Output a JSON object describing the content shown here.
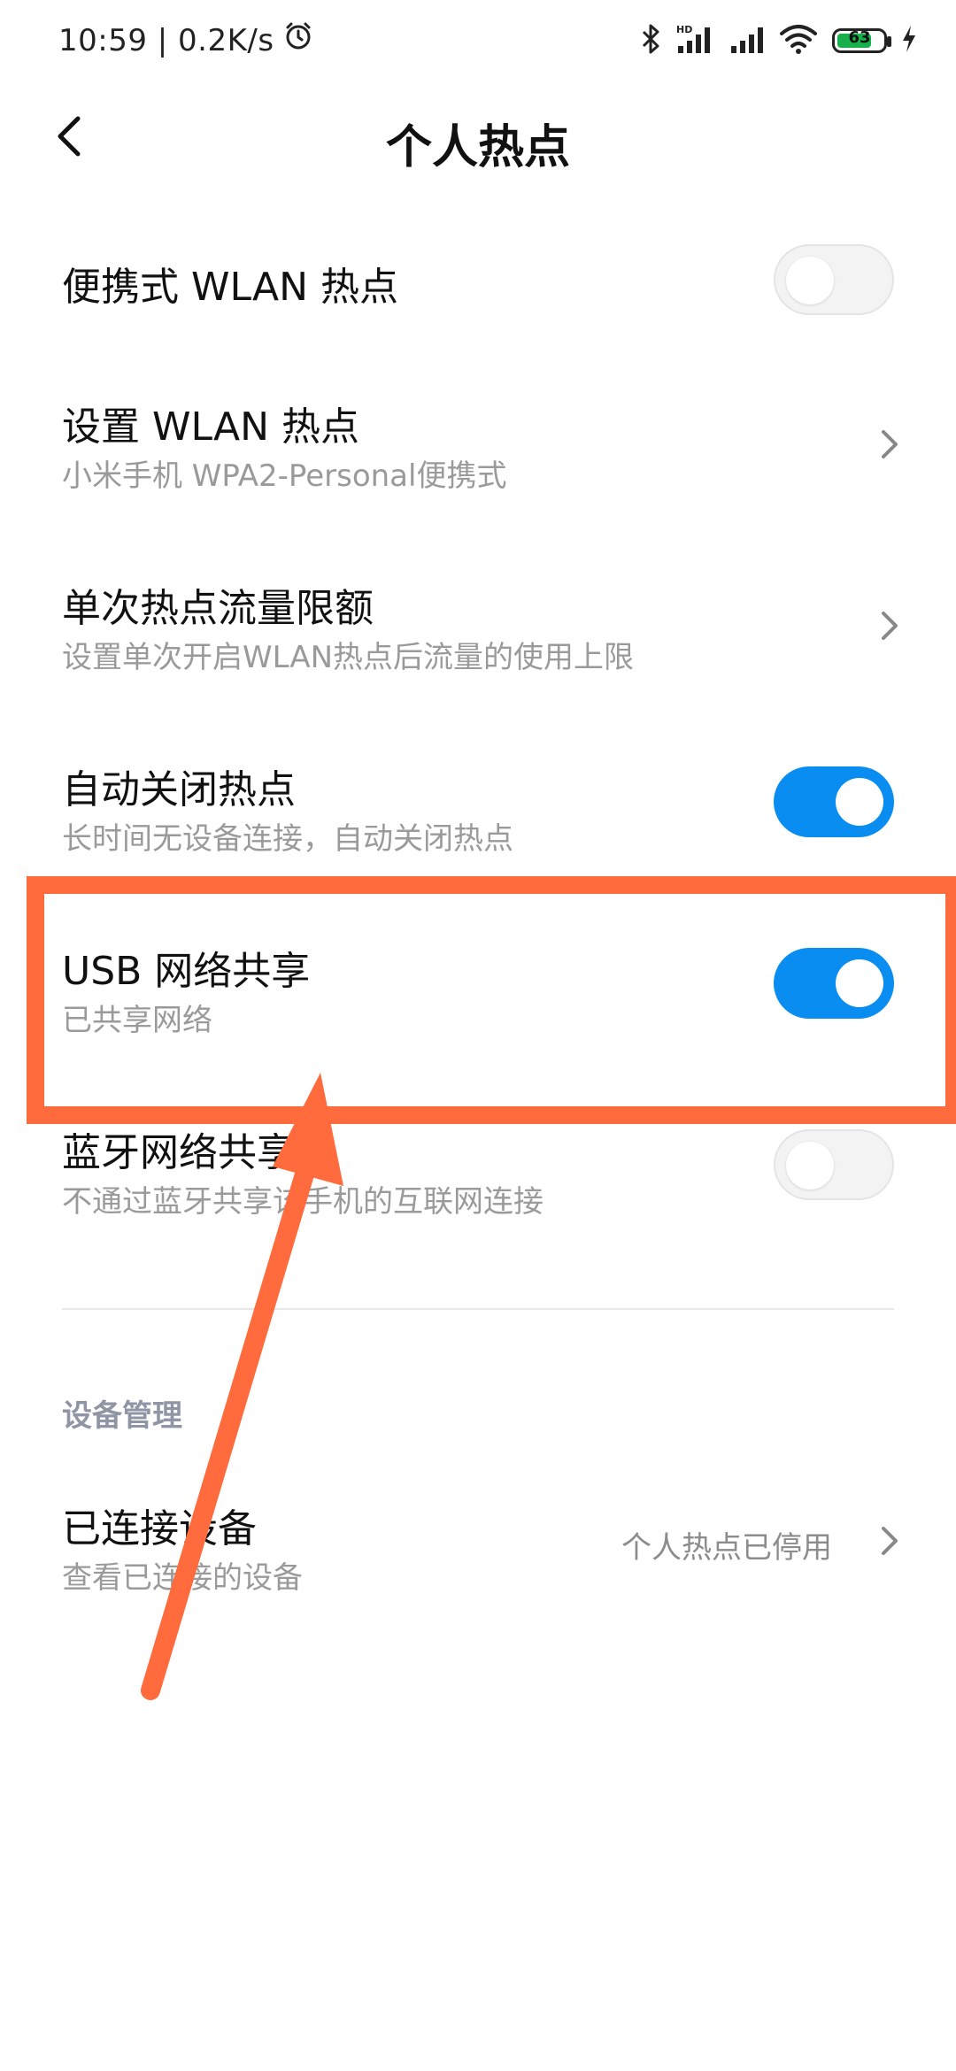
{
  "status_bar": {
    "time_speed": "10:59 | 0.2K/s",
    "battery_level": "63",
    "icons": [
      "alarm-icon",
      "bluetooth-icon",
      "hd-signal-icon",
      "signal-icon",
      "wifi-icon",
      "battery-icon",
      "charging-icon"
    ]
  },
  "header": {
    "title": "个人热点"
  },
  "settings": {
    "portable_hotspot": {
      "title": "便携式 WLAN 热点",
      "enabled": false
    },
    "setup_hotspot": {
      "title": "设置 WLAN 热点",
      "subtitle": "小米手机 WPA2-Personal便携式"
    },
    "data_limit": {
      "title": "单次热点流量限额",
      "subtitle": "设置单次开启WLAN热点后流量的使用上限"
    },
    "auto_off": {
      "title": "自动关闭热点",
      "subtitle": "长时间无设备连接，自动关闭热点",
      "enabled": true
    },
    "usb_tethering": {
      "title": "USB 网络共享",
      "subtitle": "已共享网络",
      "enabled": true
    },
    "bt_tethering": {
      "title": "蓝牙网络共享",
      "subtitle": "不通过蓝牙共享该手机的互联网连接",
      "enabled": false
    }
  },
  "device_management": {
    "section_title": "设备管理",
    "connected_devices": {
      "title": "已连接设备",
      "subtitle": "查看已连接的设备",
      "value": "个人热点已停用"
    }
  },
  "colors": {
    "accent": "#0a8df0",
    "annotation": "#ff6b3c"
  }
}
